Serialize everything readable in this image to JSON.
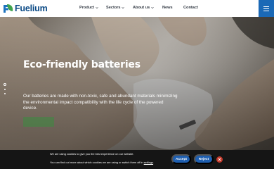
{
  "brand": {
    "name": "Fuelium",
    "color": "#0b4a86",
    "mark_colors": [
      "#1e73be",
      "#3fa34d"
    ]
  },
  "nav": {
    "items": [
      {
        "label": "Product",
        "has_dropdown": true
      },
      {
        "label": "Sectors",
        "has_dropdown": true
      },
      {
        "label": "About us",
        "has_dropdown": true
      },
      {
        "label": "News",
        "has_dropdown": false
      },
      {
        "label": "Contact",
        "has_dropdown": false
      }
    ],
    "menu_icon": "hamburger-icon",
    "menu_color": "#1b69b6"
  },
  "hero": {
    "title": "Eco-friendly batteries",
    "text": "Our batteries are made with non-toxic, safe and abundant materials minimizing the environmental impact compatibility with the life cycle of the powered device.",
    "cta_color": "#3a8c3f",
    "slides": 3,
    "active_slide": 1
  },
  "cookie": {
    "line1": "We are using cookies to give you the best experience on our website.",
    "line2_prefix": "You can find out more about which cookies we are using or switch them off in ",
    "line2_link": "settings",
    "line2_suffix": ".",
    "accept": "Accept",
    "reject": "Reject",
    "button_color": "#1f5fb0",
    "close_color": "#c43a2c"
  }
}
